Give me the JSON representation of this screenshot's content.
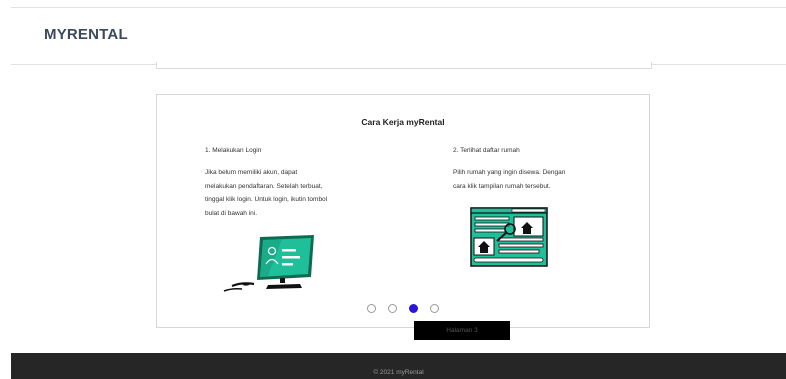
{
  "header": {
    "brand": "MYRENTAL"
  },
  "card": {
    "title": "Cara Kerja myRental",
    "steps": [
      {
        "title": "1. Melakukan Login",
        "lines": [
          "Jika belum memiliki akun, dapat",
          "melakukan pendaftaran. Setelah terbuat,",
          "tinggal klik login. Untuk login, ikutin tombol",
          "bulat di bawah ini."
        ],
        "illustration": "computer-login-icon"
      },
      {
        "title": "2. Terlihat daftar rumah",
        "lines": [
          "Pilih rumah yang ingin disewa. Dengan",
          "cara klik tampilan rumah tersebut."
        ],
        "illustration": "house-listing-icon"
      }
    ]
  },
  "carousel": {
    "slide_count": 4,
    "active_index": 2,
    "tooltip": "Halaman 3"
  },
  "footer": {
    "text": "© 2021 myRental"
  },
  "colors": {
    "accent": "#2a16d6",
    "illustration_green": "#1fbf99",
    "footer_bg": "#262626"
  }
}
